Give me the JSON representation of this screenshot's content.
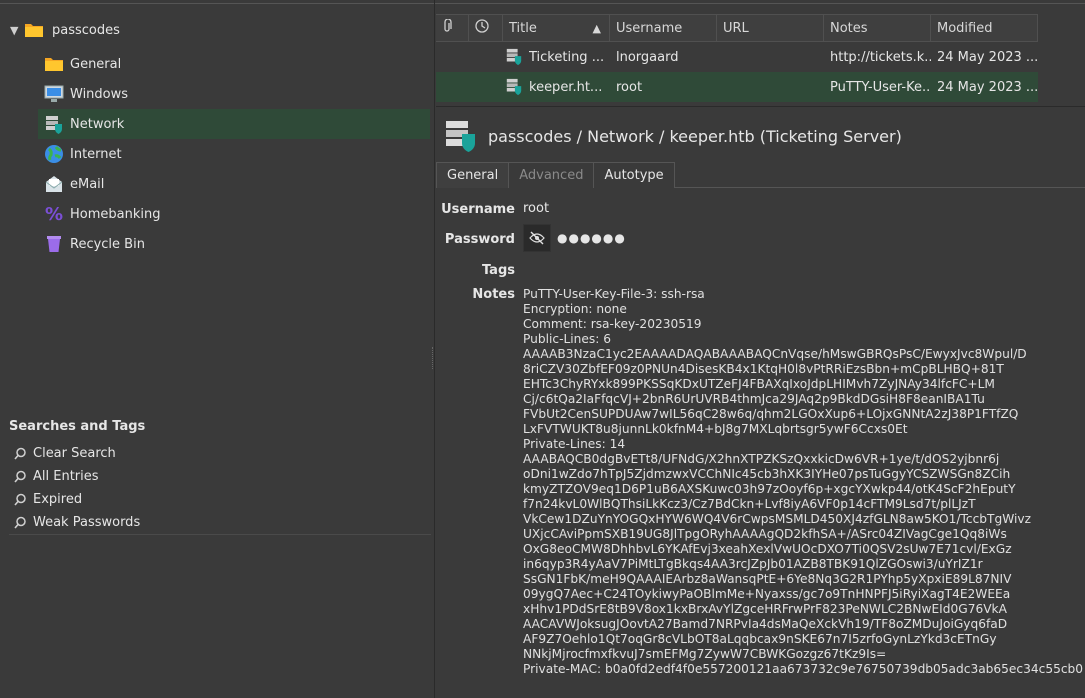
{
  "tree": {
    "root_label": "passcodes",
    "groups": [
      {
        "label": "General",
        "icon": "folder-icon"
      },
      {
        "label": "Windows",
        "icon": "windows-icon"
      },
      {
        "label": "Network",
        "icon": "network-icon"
      },
      {
        "label": "Internet",
        "icon": "globe-icon"
      },
      {
        "label": "eMail",
        "icon": "email-icon"
      },
      {
        "label": "Homebanking",
        "icon": "percent-icon"
      },
      {
        "label": "Recycle Bin",
        "icon": "recycle-bin-icon"
      }
    ],
    "selected": "Network"
  },
  "searches": {
    "title": "Searches and Tags",
    "items": [
      "Clear Search",
      "All Entries",
      "Expired",
      "Weak Passwords"
    ]
  },
  "table": {
    "headers": {
      "title": "Title",
      "username": "Username",
      "url": "URL",
      "notes": "Notes",
      "modified": "Modified"
    },
    "rows": [
      {
        "title": "Ticketing ...",
        "username": "lnorgaard",
        "url": "",
        "notes": "http://tickets.k...",
        "modified": "24 May 2023 ..."
      },
      {
        "title": "keeper.ht...",
        "username": "root",
        "url": "",
        "notes": "PuTTY-User-Ke...",
        "modified": "24 May 2023 ..."
      }
    ]
  },
  "detail": {
    "path": "passcodes / Network / keeper.htb (Ticketing Server)",
    "tabs": [
      "General",
      "Advanced",
      "Autotype"
    ],
    "labels": {
      "username": "Username",
      "password": "Password",
      "tags": "Tags",
      "notes": "Notes"
    },
    "username": "root",
    "password_mask": "●●●●●●",
    "notes": "PuTTY-User-Key-File-3: ssh-rsa\nEncryption: none\nComment: rsa-key-20230519\nPublic-Lines: 6\nAAAAB3NzaC1yc2EAAAADAQABAAABAQCnVqse/hMswGBRQsPsC/EwyxJvc8Wpul/D\n8riCZV30ZbfEF09z0PNUn4DisesKB4x1KtqH0l8vPtRRiEzsBbn+mCpBLHBQ+81T\nEHTc3ChyRYxk899PKSSqKDxUTZeFJ4FBAXqIxoJdpLHIMvh7ZyJNAy34lfcFC+LM\nCj/c6tQa2IaFfqcVJ+2bnR6UrUVRB4thmJca29JAq2p9BkdDGsiH8F8eanIBA1Tu\nFVbUt2CenSUPDUAw7wIL56qC28w6q/qhm2LGOxXup6+LOjxGNNtA2zJ38P1FTfZQ\nLxFVTWUKT8u8junnLk0kfnM4+bJ8g7MXLqbrtsgr5ywF6Ccxs0Et\nPrivate-Lines: 14\nAAABAQCB0dgBvETt8/UFNdG/X2hnXTPZKSzQxxkicDw6VR+1ye/t/dOS2yjbnr6j\noDni1wZdo7hTpJ5ZjdmzwxVCChNIc45cb3hXK3IYHe07psTuGgyYCSZWSGn8ZCih\nkmyZTZOV9eq1D6P1uB6AXSKuwc03h97zOoyf6p+xgcYXwkp44/otK4ScF2hEputY\nf7n24kvL0WlBQThsiLkKcz3/Cz7BdCkn+Lvf8iyA6VF0p14cFTM9Lsd7t/plLJzT\nVkCew1DZuYnYOGQxHYW6WQ4V6rCwpsMSMLD450XJ4zfGLN8aw5KO1/TccbTgWivz\nUXjcCAviPpmSXB19UG8JlTpgORyhAAAAgQD2kfhSA+/ASrc04ZIVagCge1Qq8iWs\nOxG8eoCMW8DhhbvL6YKAfEvj3xeahXexlVwUOcDXO7Ti0QSV2sUw7E71cvl/ExGz\nin6qyp3R4yAaV7PiMtLTgBkqs4AA3rcJZpJb01AZB8TBK91QlZGOswi3/uYrIZ1r\nSsGN1FbK/meH9QAAAIEArbz8aWansqPtE+6Ye8Nq3G2R1PYhp5yXpxiE89L87NIV\n09ygQ7Aec+C24TOykiwyPaOBlmMe+Nyaxss/gc7o9TnHNPFJ5iRyiXagT4E2WEEa\nxHhv1PDdSrE8tB9V8ox1kxBrxAvYlZgceHRFrwPrF823PeNWLC2BNwEId0G76VkA\nAACAVWJoksugJOovtA27Bamd7NRPvIa4dsMaQeXckVh19/TF8oZMDuJoiGyq6faD\nAF9Z7Oehlo1Qt7oqGr8cVLbOT8aLqqbcax9nSKE67n7I5zrfoGynLzYkd3cETnGy\nNNkjMjrocfmxfkvuJ7smEFMg7ZywW7CBWKGozgz67tKz9Is=\nPrivate-MAC: b0a0fd2edf4f0e557200121aa673732c9e76750739db05adc3ab65ec34c55cb0"
  },
  "colors": {
    "background": "#3a3a3a",
    "selection": "#2f4a38",
    "folder": "#f5c518",
    "accent_teal": "#1aa39a"
  }
}
